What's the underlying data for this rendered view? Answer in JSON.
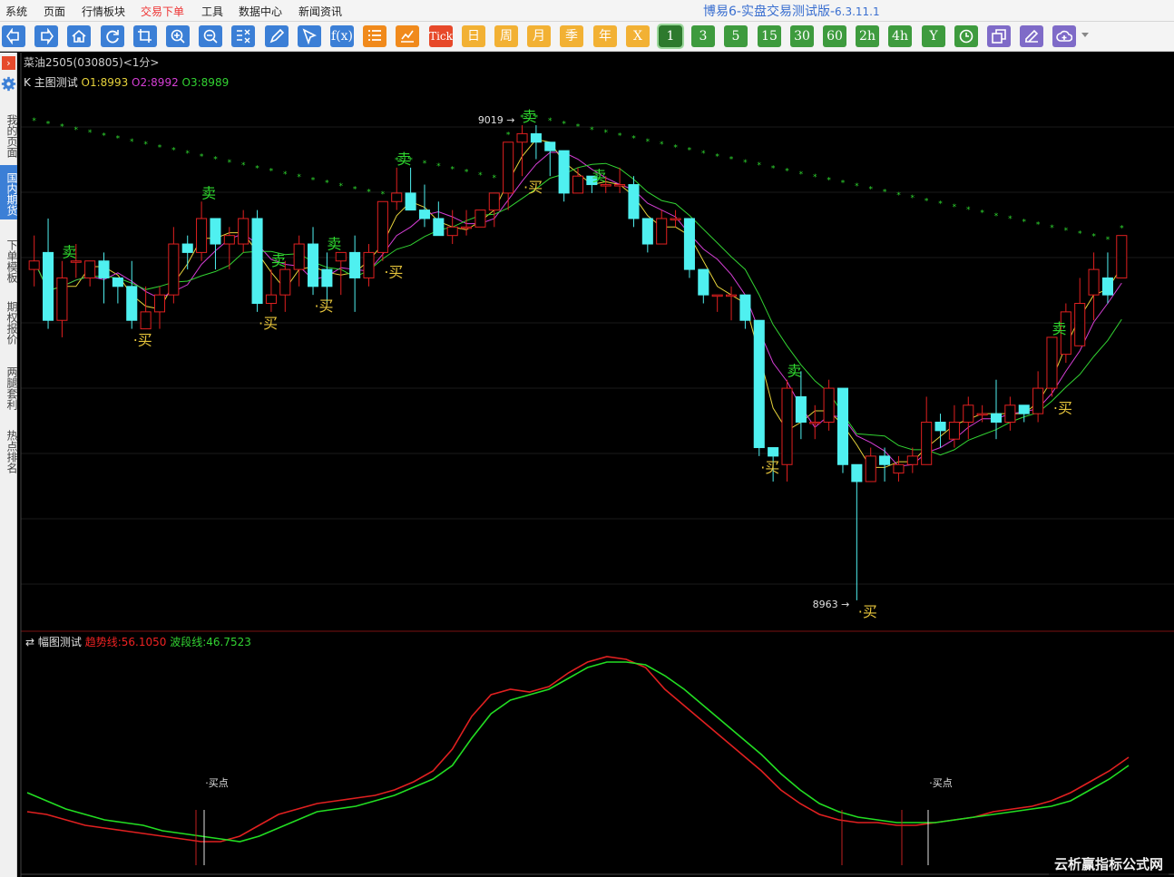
{
  "menu": {
    "items": [
      "系统",
      "页面",
      "行情板块",
      "交易下单",
      "工具",
      "数据中心",
      "新闻资讯"
    ],
    "active": "交易下单"
  },
  "app": {
    "title": "博易6-实盘交易测试版-",
    "version": "6.3.11.1"
  },
  "toolbar": {
    "icons": [
      "back-icon",
      "forward-icon",
      "home-icon",
      "refresh-icon",
      "crop-icon",
      "zoom-in-icon",
      "zoom-out-icon",
      "compare-icon",
      "draw-pen-icon",
      "cursor-icon",
      "formula-icon",
      "list-icon",
      "indicator-chart-icon"
    ],
    "periods": [
      "Tick",
      "日",
      "周",
      "月",
      "季",
      "年",
      "X",
      "1",
      "3",
      "5",
      "15",
      "30",
      "60",
      "2h",
      "4h",
      "Y"
    ],
    "active_period": "1",
    "tail_icons": [
      "clock-icon",
      "window-icon",
      "note-icon",
      "cloud-add-icon"
    ],
    "formula_label": "f(x)"
  },
  "sidebar": {
    "items": [
      "我的页面",
      "国内期货",
      "下单模板",
      "期权报价",
      "两腿套利",
      "热点排名"
    ],
    "active": "国内期货"
  },
  "contract": {
    "name": "菜油2505(030805)",
    "period": "<1分>"
  },
  "main_indicator": {
    "prefix": "K",
    "name": "主图测试",
    "o1_label": "O1:",
    "o1_value": "8993",
    "o2_label": "O2:",
    "o2_value": "8992",
    "o3_label": "O3:",
    "o3_value": "8989"
  },
  "sub_indicator": {
    "name": "幅图测试",
    "trend_label": "趋势线:",
    "trend_value": "56.1050",
    "wave_label": "波段线:",
    "wave_value": "46.7523"
  },
  "labels": {
    "sell": "卖",
    "buy": "·买",
    "buy_point": "·买点",
    "high": "9019",
    "low": "8963"
  },
  "colors": {
    "up": "#e02020",
    "down": "#4ff0f0",
    "o1": "#e6d23b",
    "o2": "#d63fd6",
    "o3": "#32d232",
    "trend": "#e02020",
    "wave": "#22dd22"
  },
  "watermark": "云析赢指标公式网",
  "chart_data": {
    "type": "candlestick",
    "y_range": [
      8963,
      9019
    ],
    "candles": [
      [
        9002,
        9003,
        9006,
        9000
      ],
      [
        9004,
        8996,
        9008,
        8995
      ],
      [
        8996,
        9001,
        9003,
        8994
      ],
      [
        9003,
        9003,
        9005,
        9001
      ],
      [
        9001,
        9003,
        9003,
        9000
      ],
      [
        9003,
        9001,
        9004,
        8998
      ],
      [
        9001,
        9000,
        9001,
        8998
      ],
      [
        9000,
        8996,
        9003,
        8995
      ],
      [
        8995,
        8997,
        9000,
        8995
      ],
      [
        8997,
        8999,
        9000,
        8995
      ],
      [
        8999,
        9005,
        9007,
        8998
      ],
      [
        9005,
        9004,
        9006,
        9002
      ],
      [
        9004,
        9008,
        9010,
        9003
      ],
      [
        9008,
        9005,
        9008,
        9002
      ],
      [
        9005,
        9006,
        9007,
        9002
      ],
      [
        9005,
        9008,
        9009,
        9004
      ],
      [
        9008,
        8998,
        9009,
        8997
      ],
      [
        8998,
        8999,
        9002,
        8997
      ],
      [
        8999,
        9002,
        9003,
        8997
      ],
      [
        9002,
        9005,
        9006,
        9000
      ],
      [
        9005,
        9000,
        9007,
        8999
      ],
      [
        9002,
        9000,
        9004,
        8998
      ],
      [
        9003,
        9004,
        9004,
        8999
      ],
      [
        9004,
        9001,
        9006,
        8997
      ],
      [
        9001,
        9004,
        9005,
        9000
      ],
      [
        9004,
        9010,
        9010,
        9003
      ],
      [
        9010,
        9011,
        9014,
        9009
      ],
      [
        9011,
        9009,
        9014,
        9009
      ],
      [
        9009,
        9008,
        9012,
        9007
      ],
      [
        9008,
        9006,
        9010,
        9006
      ],
      [
        9006,
        9007,
        9009,
        9005
      ],
      [
        9007,
        9007,
        9009,
        9006
      ],
      [
        9007,
        9009,
        9009,
        9007
      ],
      [
        9009,
        9011,
        9011,
        9007
      ],
      [
        9011,
        9017,
        9017,
        9009
      ],
      [
        9017,
        9018,
        9019,
        9013
      ],
      [
        9018,
        9017,
        9019,
        9015
      ],
      [
        9017,
        9016,
        9016,
        9013
      ],
      [
        9016,
        9011,
        9016,
        9010
      ],
      [
        9011,
        9013,
        9014,
        9011
      ],
      [
        9013,
        9012,
        9012,
        9011
      ],
      [
        9012,
        9012,
        9013,
        9011
      ],
      [
        9012,
        9012,
        9014,
        9011
      ],
      [
        9012,
        9008,
        9013,
        9007
      ],
      [
        9008,
        9005,
        9008,
        9004
      ],
      [
        9005,
        9008,
        9009,
        9005
      ],
      [
        9008,
        9008,
        9009,
        9007
      ],
      [
        9008,
        9002,
        9008,
        9001
      ],
      [
        9002,
        8999,
        9002,
        8998
      ],
      [
        8999,
        8999,
        8999,
        8997
      ],
      [
        8999,
        8999,
        9000,
        8996
      ],
      [
        8999,
        8996,
        8999,
        8995
      ],
      [
        8996,
        8981,
        8996,
        8980
      ],
      [
        8981,
        8980,
        8981,
        8977
      ],
      [
        8979,
        8988,
        8989,
        8977
      ],
      [
        8987,
        8984,
        8990,
        8982
      ],
      [
        8984,
        8984,
        8986,
        8982
      ],
      [
        8984,
        8988,
        8989,
        8983
      ],
      [
        8988,
        8979,
        8988,
        8978
      ],
      [
        8979,
        8977,
        8979,
        8963
      ],
      [
        8977,
        8980,
        8981,
        8977
      ],
      [
        8980,
        8979,
        8981,
        8977
      ],
      [
        8978,
        8979,
        8980,
        8977
      ],
      [
        8979,
        8980,
        8981,
        8978
      ],
      [
        8979,
        8984,
        8987,
        8979
      ],
      [
        8984,
        8983,
        8985,
        8981
      ],
      [
        8982,
        8984,
        8986,
        8981
      ],
      [
        8984,
        8986,
        8987,
        8982
      ],
      [
        8985,
        8985,
        8986,
        8984
      ],
      [
        8985,
        8984,
        8989,
        8982
      ],
      [
        8984,
        8986,
        8987,
        8983
      ],
      [
        8986,
        8985,
        8986,
        8984
      ],
      [
        8985,
        8988,
        8990,
        8984
      ],
      [
        8988,
        8994,
        8994,
        8987
      ],
      [
        8992,
        8997,
        8998,
        8991
      ],
      [
        8993,
        8998,
        9001,
        8993
      ],
      [
        8999,
        9002,
        9004,
        8996
      ],
      [
        9001,
        8999,
        9004,
        8998
      ],
      [
        9001,
        9006,
        9006,
        9001
      ]
    ],
    "buy_markers_index": [
      7,
      16,
      20,
      25,
      35,
      52,
      59,
      73
    ],
    "sell_markers_index": [
      2,
      12,
      17,
      21,
      26,
      35,
      40,
      54,
      73
    ],
    "sub_trend": [
      41,
      40,
      38,
      36,
      35,
      34,
      33,
      32,
      31,
      30,
      30,
      32,
      36,
      40,
      42,
      44,
      45,
      46,
      47,
      49,
      52,
      56,
      64,
      76,
      84,
      86,
      85,
      87,
      92,
      96,
      98,
      97,
      94,
      86,
      80,
      74,
      68,
      62,
      56,
      49,
      44,
      40,
      38,
      37,
      37,
      36,
      36,
      37,
      38,
      39,
      41,
      42,
      43,
      45,
      48,
      52,
      56,
      61
    ],
    "sub_wave": [
      48,
      45,
      42,
      40,
      38,
      37,
      36,
      34,
      33,
      32,
      31,
      30,
      32,
      35,
      38,
      41,
      42,
      43,
      45,
      47,
      50,
      53,
      58,
      68,
      77,
      82,
      84,
      86,
      90,
      94,
      96,
      96,
      95,
      91,
      86,
      80,
      74,
      68,
      62,
      55,
      49,
      44,
      41,
      39,
      38,
      37,
      37,
      37,
      38,
      39,
      40,
      41,
      42,
      43,
      45,
      49,
      53,
      58
    ]
  }
}
